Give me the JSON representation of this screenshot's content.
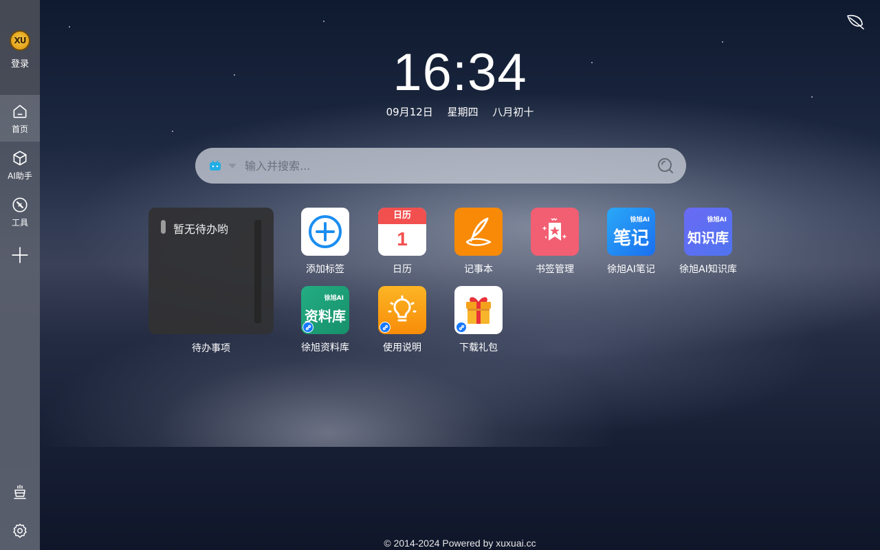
{
  "sidebar": {
    "login_label": "登录",
    "avatar_text": "XU",
    "items": [
      {
        "label": "首页",
        "icon": "home-icon"
      },
      {
        "label": "AI助手",
        "icon": "cube-icon"
      },
      {
        "label": "工具",
        "icon": "compass-icon"
      }
    ],
    "add_icon": "plus-icon",
    "bottom_icons": [
      "cup-icon",
      "gear-icon"
    ]
  },
  "clock": {
    "time": "16:34",
    "date": "09月12日",
    "weekday": "星期四",
    "lunar": "八月初十"
  },
  "search": {
    "placeholder": "输入并搜索...",
    "engine_icon": "bilibili-icon"
  },
  "todo": {
    "empty_text": "暂无待办哟",
    "label": "待办事项"
  },
  "apps": [
    {
      "label": "添加标签",
      "icon": "plus-circle-icon"
    },
    {
      "label": "日历",
      "icon": "calendar-icon",
      "header": "日历",
      "day": "1"
    },
    {
      "label": "记事本",
      "icon": "quill-icon"
    },
    {
      "label": "书签管理",
      "icon": "bookmark-icon"
    },
    {
      "label": "徐旭AI笔记",
      "icon": "notes-icon",
      "tag": "徐旭AI",
      "text": "笔记"
    },
    {
      "label": "徐旭AI知识库",
      "icon": "knowledge-icon",
      "tag": "徐旭AI",
      "text": "知识库"
    },
    {
      "label": "徐旭资料库",
      "icon": "library-icon",
      "tag": "徐旭AI",
      "text": "资料库"
    },
    {
      "label": "使用说明",
      "icon": "lightbulb-icon"
    },
    {
      "label": "下载礼包",
      "icon": "gift-icon"
    }
  ],
  "footer": "© 2014-2024 Powered by xuxuai.cc",
  "colors": {
    "calendar_red": "#f2504f",
    "notepad_orange": "#f88a07",
    "bookmark_pink": "#f25e72",
    "notes_blue": "#1f8cf5",
    "knowledge_purple": "#5d6cf2",
    "library_green": "#1c9b73",
    "bulb_orange": "#fa9a12",
    "link_badge_blue": "#1677ff"
  }
}
